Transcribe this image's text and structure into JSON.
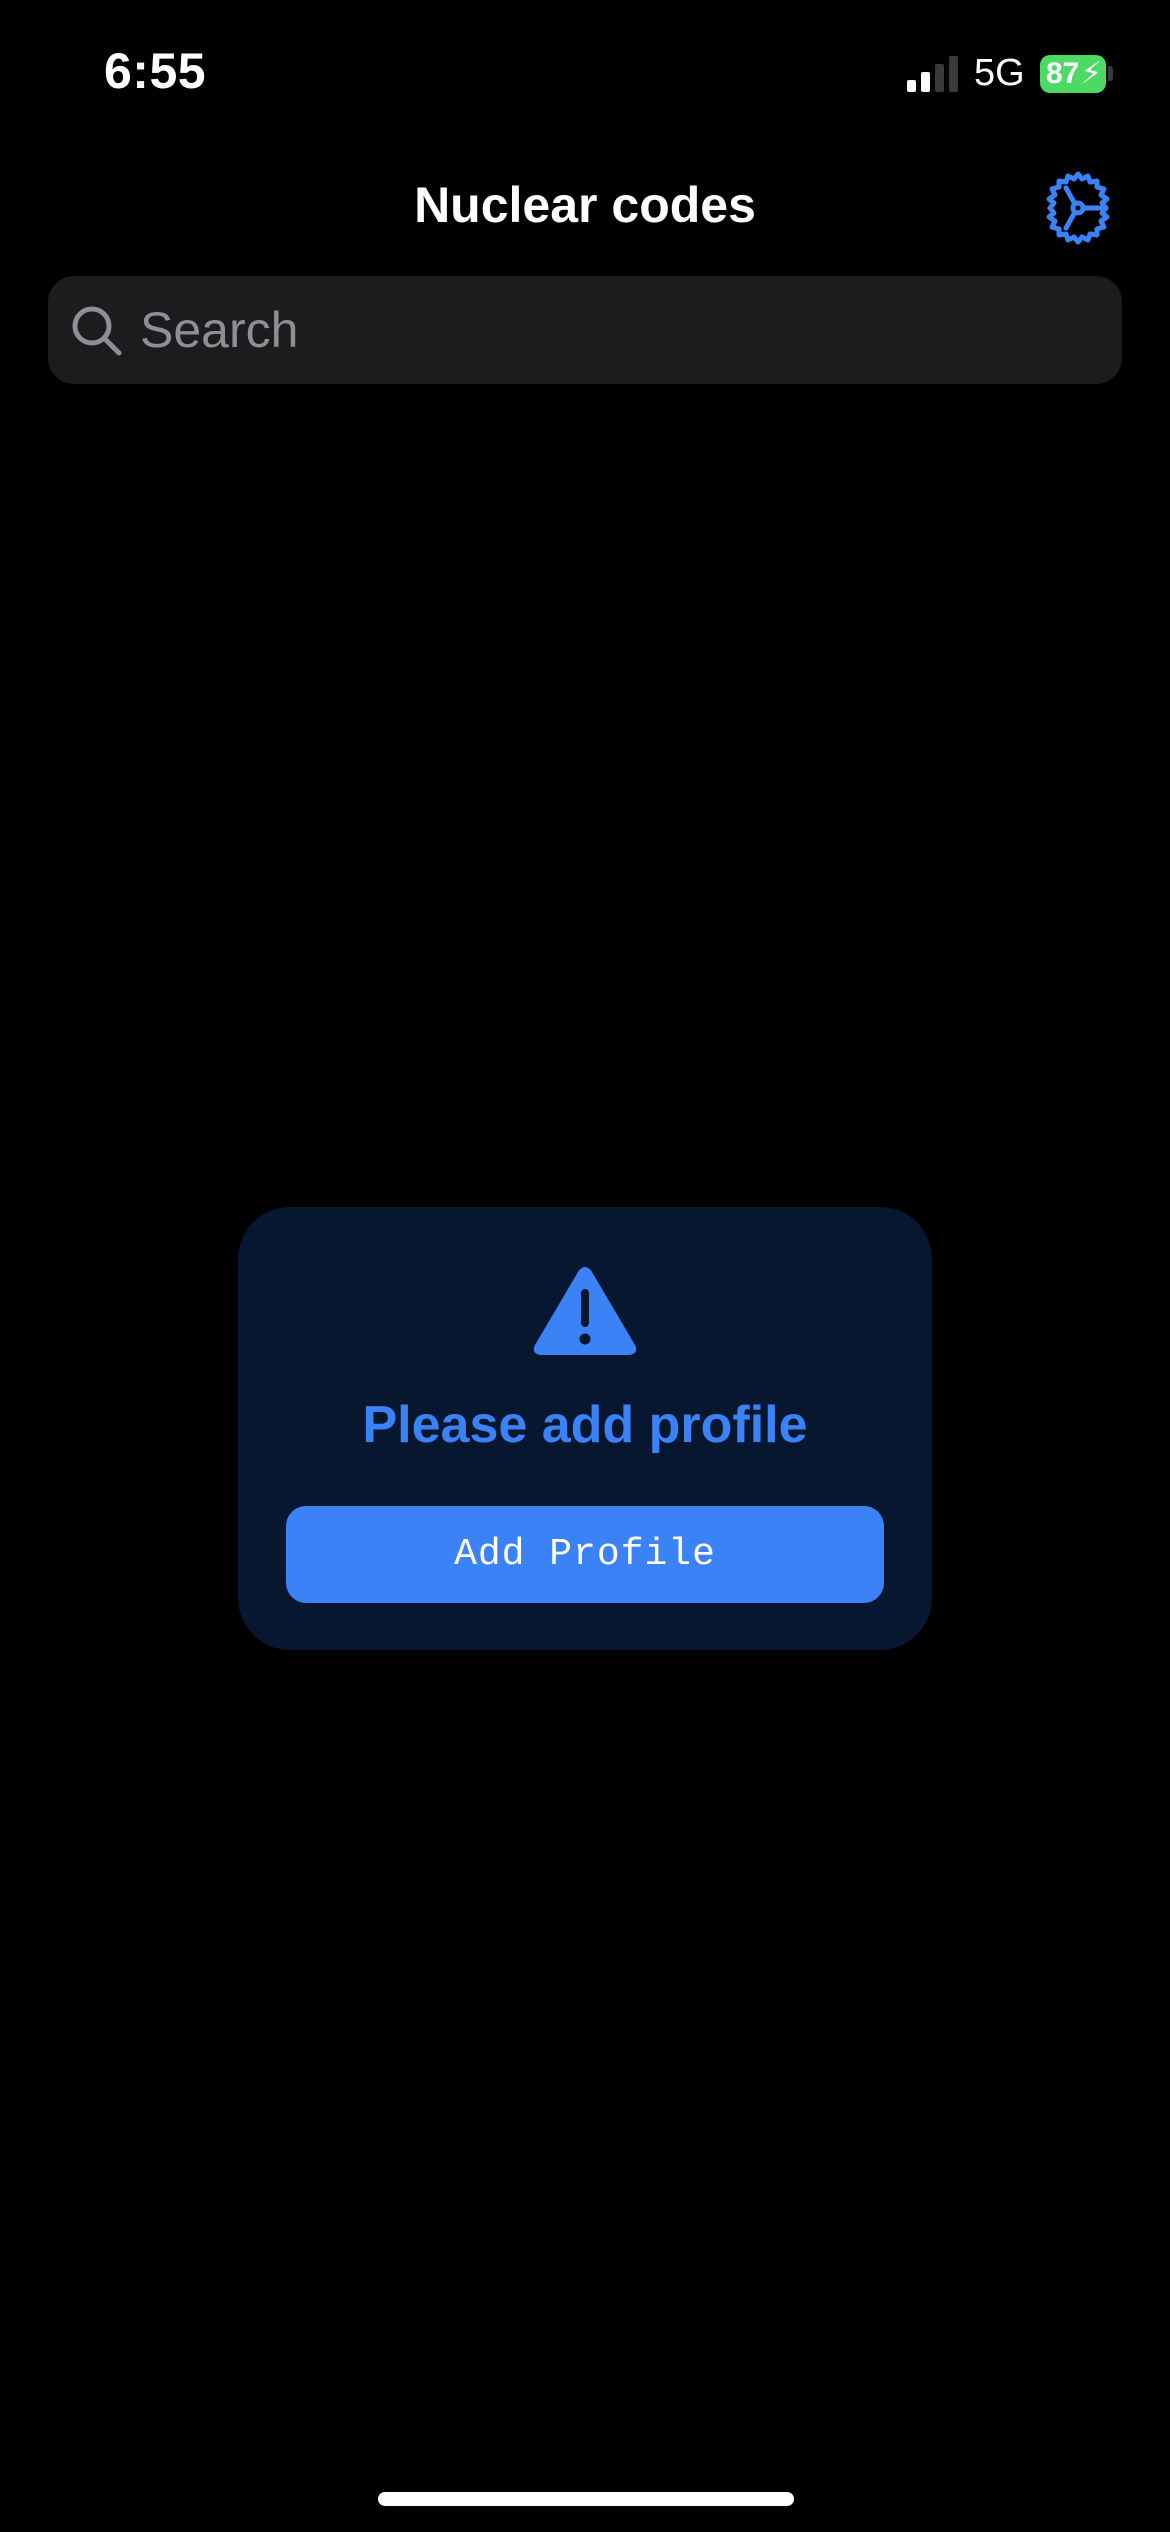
{
  "status_bar": {
    "time": "6:55",
    "network": "5G",
    "battery_level": "87",
    "battery_charging_glyph": "⚡",
    "signal_bars_active": 2,
    "signal_bars_total": 4,
    "battery_color": "#4cd964"
  },
  "nav": {
    "title": "Nuclear codes",
    "settings_icon": "gear-icon"
  },
  "search": {
    "placeholder": "Search",
    "value": "",
    "icon": "search-icon"
  },
  "empty_state": {
    "icon": "warning-triangle-icon",
    "message": "Please add profile",
    "button_label": "Add Profile"
  },
  "colors": {
    "background": "#000000",
    "accent": "#3b82f6",
    "card_background": "#081730",
    "search_background": "#1c1c1e",
    "placeholder": "#8e8e93"
  }
}
